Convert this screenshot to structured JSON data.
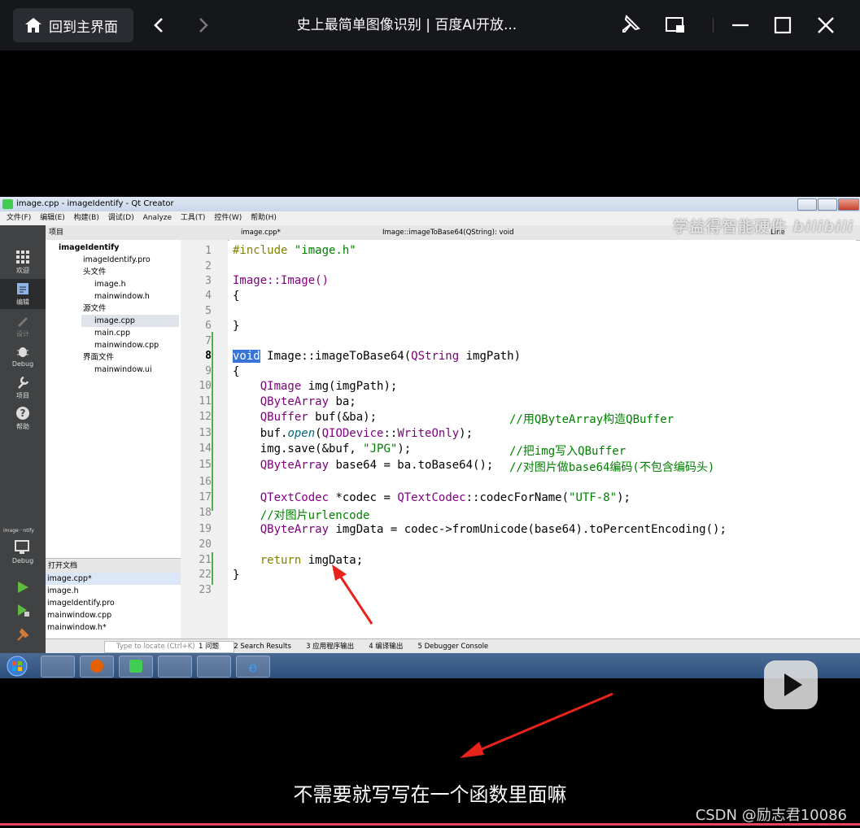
{
  "player": {
    "home_label": "回到主界面",
    "title": "史上最简单图像识别 | 百度AI开放..."
  },
  "qt": {
    "window_title": "image.cpp - imageIdentify - Qt Creator",
    "menu": [
      "文件(F)",
      "编辑(E)",
      "构建(B)",
      "调试(D)",
      "Analyze",
      "工具(T)",
      "控件(W)",
      "帮助(H)"
    ],
    "watermark": "学益得智能硬件",
    "watermark_logo": "bilibili",
    "sidebar": [
      "欢迎",
      "编辑",
      "设计",
      "Debug",
      "项目",
      "帮助"
    ],
    "kit_label": "image···ntify",
    "kit_debug": "Debug",
    "project_header": "项目",
    "tree": [
      {
        "label": "imageIdentify",
        "level": 0
      },
      {
        "label": "imageIdentify.pro",
        "level": 1
      },
      {
        "label": "头文件",
        "level": 1
      },
      {
        "label": "image.h",
        "level": 2
      },
      {
        "label": "mainwindow.h",
        "level": 2
      },
      {
        "label": "源文件",
        "level": 1
      },
      {
        "label": "image.cpp",
        "level": 2
      },
      {
        "label": "main.cpp",
        "level": 2
      },
      {
        "label": "mainwindow.cpp",
        "level": 2
      },
      {
        "label": "界面文件",
        "level": 1
      },
      {
        "label": "mainwindow.ui",
        "level": 2
      }
    ],
    "opendocs_header": "打开文档",
    "opendocs": [
      "image.cpp*",
      "image.h",
      "imageIdentify.pro",
      "mainwindow.cpp",
      "mainwindow.h*"
    ],
    "editor_tab": "image.cpp*",
    "editor_symbol": "Image::imageToBase64(QString): void",
    "editor_right": "Line",
    "line_numbers": [
      "1",
      "2",
      "3",
      "4",
      "5",
      "6",
      "7",
      "8",
      "9",
      "10",
      "11",
      "12",
      "13",
      "14",
      "15",
      "16",
      "17",
      "18",
      "19",
      "20",
      "21",
      "22",
      "23"
    ],
    "locate_placeholder": "Type to locate (Ctrl+K)",
    "output_tabs": [
      "1 问题",
      "2 Search Results",
      "3 应用程序输出",
      "4 编译输出",
      "5 Debugger Console"
    ]
  },
  "code": {
    "l1a": "#include ",
    "l1b": "\"image.h\"",
    "l3": "Image::Image()",
    "l4": "{",
    "l6": "}",
    "l8a": "void",
    "l8b": " Image::imageToBase64(",
    "l8c": "QString",
    "l8d": " imgPath)",
    "l9": "{",
    "l10a": "    ",
    "l10b": "QImage",
    "l10c": " img(imgPath);",
    "l11a": "    ",
    "l11b": "QByteArray",
    "l11c": " ba;",
    "l12a": "    ",
    "l12b": "QBuffer",
    "l12c": " buf(&ba);",
    "l12d": "//用QByteArray构造QBuffer",
    "l13a": "    buf.",
    "l13b": "open",
    "l13c": "(",
    "l13d": "QIODevice",
    "l13e": "::",
    "l13f": "WriteOnly",
    "l13g": ");",
    "l14a": "    img.save(&buf, ",
    "l14b": "\"JPG\"",
    "l14c": ");",
    "l14d": "//把img写入QBuffer",
    "l15a": "    ",
    "l15b": "QByteArray",
    "l15c": " base64 = ba.toBase64();",
    "l15d": "//对图片做base64编码(不包含编码头)",
    "l17a": "    ",
    "l17b": "QTextCodec",
    "l17c": " *codec = ",
    "l17d": "QTextCodec",
    "l17e": "::codecForName(",
    "l17f": "\"UTF-8\"",
    "l17g": ");",
    "l18": "    //对图片urlencode",
    "l19a": "    ",
    "l19b": "QByteArray",
    "l19c": " imgData = codec->fromUnicode(base64).toPercentEncoding();",
    "l21a": "    ",
    "l21b": "return",
    "l21c": " imgData;",
    "l22": "}"
  },
  "subtitle": "不需要就写写在一个函数里面嘛",
  "credit": "CSDN @励志君10086",
  "colors": {
    "accent_progress": "#e6455a",
    "arrow": "#e8231c"
  }
}
